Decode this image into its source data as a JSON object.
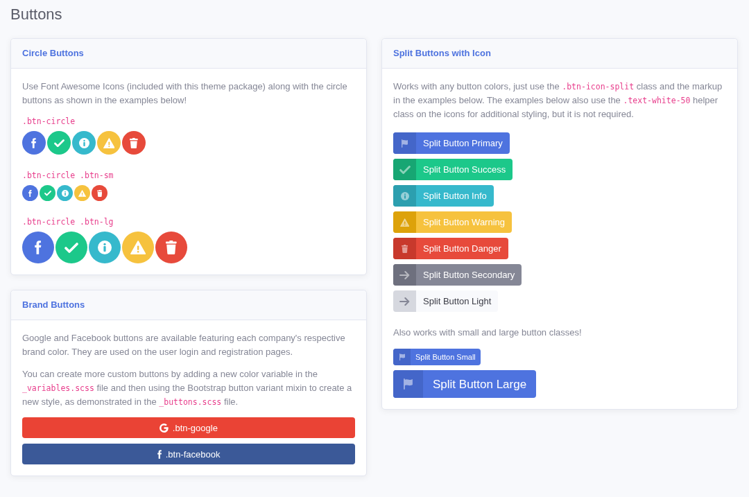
{
  "page_title": "Buttons",
  "circle_card": {
    "title": "Circle Buttons",
    "intro": [
      {
        "kind": "text",
        "text": "Use Font Awesome Icons (included with this theme package) along with the circle buttons as shown in the examples below!"
      }
    ],
    "groups": [
      {
        "label": ".btn-circle",
        "buttons": [
          {
            "kind": "facebook"
          },
          {
            "kind": "success"
          },
          {
            "kind": "info"
          },
          {
            "kind": "warning"
          },
          {
            "kind": "danger"
          }
        ]
      },
      {
        "label": ".btn-circle .btn-sm",
        "buttons": [
          {
            "kind": "facebook"
          },
          {
            "kind": "success"
          },
          {
            "kind": "info"
          },
          {
            "kind": "warning"
          },
          {
            "kind": "danger"
          }
        ]
      },
      {
        "label": ".btn-circle .btn-lg",
        "buttons": [
          {
            "kind": "facebook"
          },
          {
            "kind": "success"
          },
          {
            "kind": "info"
          },
          {
            "kind": "warning"
          },
          {
            "kind": "danger"
          }
        ]
      }
    ]
  },
  "brand_card": {
    "title": "Brand Buttons",
    "paragraphs": [
      [
        {
          "kind": "text",
          "text": "Google and Facebook buttons are available featuring each company's respective brand color. They are used on the user login and registration pages."
        }
      ],
      [
        {
          "kind": "text",
          "text": "You can create more custom buttons by adding a new color variable in the "
        },
        {
          "kind": "code",
          "text": "_variables.scss"
        },
        {
          "kind": "text",
          "text": " file and then using the Bootstrap button variant mixin to create a new style, as demonstrated in the "
        },
        {
          "kind": "code",
          "text": "_buttons.scss"
        },
        {
          "kind": "text",
          "text": " file."
        }
      ]
    ],
    "buttons": [
      {
        "kind": "google",
        "label": ".btn-google"
      },
      {
        "kind": "facebook",
        "label": ".btn-facebook"
      }
    ]
  },
  "split_card": {
    "title": "Split Buttons with Icon",
    "intro": [
      {
        "kind": "text",
        "text": "Works with any button colors, just use the "
      },
      {
        "kind": "code",
        "text": ".btn-icon-split"
      },
      {
        "kind": "text",
        "text": " class and the markup in the examples below. The examples below also use the "
      },
      {
        "kind": "code",
        "text": ".text-white-50"
      },
      {
        "kind": "text",
        "text": " helper class on the icons for additional styling, but it is not required."
      }
    ],
    "buttons": [
      {
        "kind": "primary",
        "label": "Split Button Primary"
      },
      {
        "kind": "success",
        "label": "Split Button Success"
      },
      {
        "kind": "info",
        "label": "Split Button Info"
      },
      {
        "kind": "warning",
        "label": "Split Button Warning"
      },
      {
        "kind": "danger",
        "label": "Split Button Danger"
      },
      {
        "kind": "secondary",
        "label": "Split Button Secondary"
      },
      {
        "kind": "light",
        "label": "Split Button Light"
      }
    ],
    "note": "Also works with small and large button classes!",
    "size_buttons": [
      {
        "kind": "small",
        "label": "Split Button Small"
      },
      {
        "kind": "large",
        "label": "Split Button Large"
      }
    ]
  }
}
